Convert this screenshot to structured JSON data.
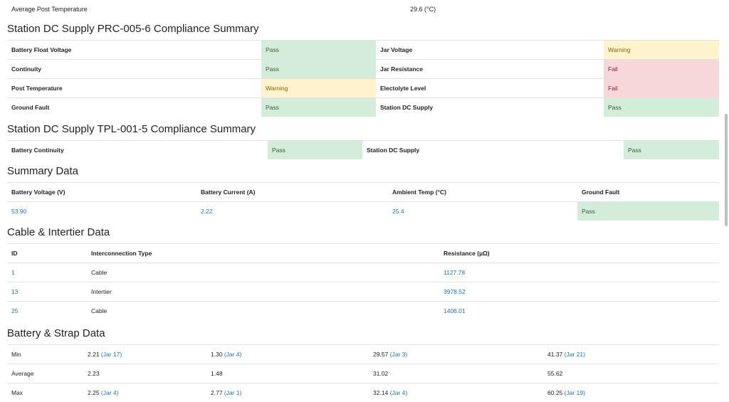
{
  "top": {
    "label": "Average Post Temperature",
    "value": "29.6 (°C)"
  },
  "prc": {
    "title": "Station DC Supply PRC-005-6 Compliance Summary",
    "rows": [
      {
        "l1": "Battery Float Voltage",
        "v1": "Pass",
        "l2": "Jar Voltage",
        "v2": "Warning"
      },
      {
        "l1": "Continuity",
        "v1": "Pass",
        "l2": "Jar Resistance",
        "v2": "Fail"
      },
      {
        "l1": "Post Temperature",
        "v1": "Warning",
        "l2": "Electolyte Level",
        "v2": "Fail"
      },
      {
        "l1": "Ground Fault",
        "v1": "Pass",
        "l2": "Station DC Supply",
        "v2": "Pass"
      }
    ]
  },
  "tpl": {
    "title": "Station DC Supply TPL-001-5 Compliance Summary",
    "l1": "Battery Continuity",
    "v1": "Pass",
    "l2": "Station DC Supply",
    "v2": "Pass"
  },
  "summary": {
    "title": "Summary Data",
    "headers": [
      "Battery Voltage (V)",
      "Battery Current (A)",
      "Ambient Temp (°C)",
      "Ground Fault"
    ],
    "values": [
      "53.90",
      "2.22",
      "25.4",
      "Pass"
    ]
  },
  "cable": {
    "title": "Cable & Intertier Data",
    "headers": [
      "ID",
      "Interconnection Type",
      "Resistance (µΩ)"
    ],
    "rows": [
      {
        "id": "1",
        "type": "Cable",
        "res": "1127.78"
      },
      {
        "id": "13",
        "type": "Intertier",
        "res": "3978.52"
      },
      {
        "id": "25",
        "type": "Cable",
        "res": "1406.01"
      }
    ]
  },
  "battery": {
    "title": "Battery & Strap Data",
    "rows": [
      {
        "label": "Min",
        "c1": "2.21",
        "j1": "(Jar 17)",
        "c2": "1.30",
        "j2": "(Jar 4)",
        "c3": "29.57",
        "j3": "(Jar 3)",
        "c4": "41.37",
        "j4": "(Jar 21)"
      },
      {
        "label": "Average",
        "c1": "2.23",
        "j1": "",
        "c2": "1.48",
        "j2": "",
        "c3": "31.02",
        "j3": "",
        "c4": "55.62",
        "j4": ""
      },
      {
        "label": "Max",
        "c1": "2.25",
        "j1": "(Jar 4)",
        "c2": "2.77",
        "j2": "(Jar 1)",
        "c3": "32.14",
        "j3": "(Jar 4)",
        "c4": "60.25",
        "j4": "(Jar 19)"
      }
    ]
  }
}
